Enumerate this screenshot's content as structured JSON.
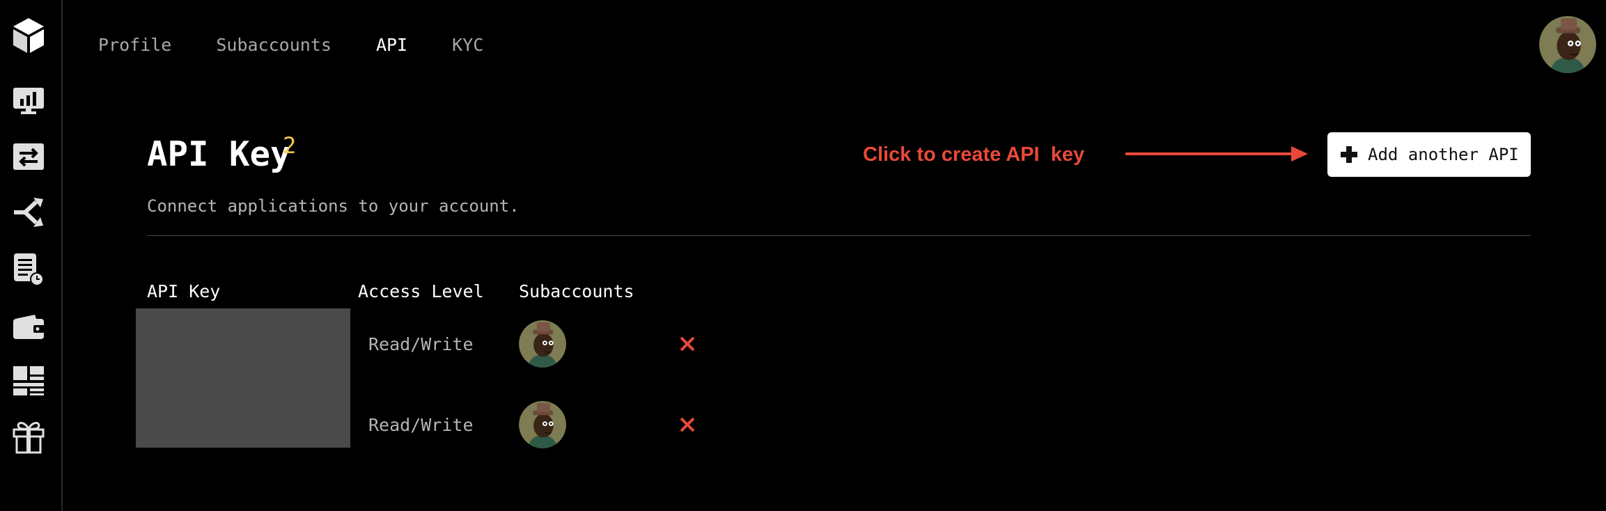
{
  "sidebar": {
    "items": [
      {
        "icon": "logo-cube-icon"
      },
      {
        "icon": "dashboard-chart-icon"
      },
      {
        "icon": "transfer-arrows-icon"
      },
      {
        "icon": "split-arrows-icon"
      },
      {
        "icon": "history-document-icon"
      },
      {
        "icon": "wallet-icon"
      },
      {
        "icon": "grid-table-icon"
      },
      {
        "icon": "gift-icon"
      }
    ]
  },
  "nav": {
    "tabs": [
      {
        "label": "Profile",
        "active": false
      },
      {
        "label": "Subaccounts",
        "active": false
      },
      {
        "label": "API",
        "active": true
      },
      {
        "label": "KYC",
        "active": false
      }
    ]
  },
  "header": {
    "title": "API Key",
    "count": "2",
    "subtitle": "Connect applications to your account.",
    "annotation": "Click to create API  key",
    "add_button_label": "Add another API"
  },
  "table": {
    "headers": [
      "API Key",
      "Access Level",
      "Subaccounts"
    ],
    "rows": [
      {
        "access_level": "Read/Write",
        "subaccount_icon": "avatar-icon",
        "action_icon": "delete-x-icon"
      },
      {
        "access_level": "Read/Write",
        "subaccount_icon": "avatar-icon",
        "action_icon": "delete-x-icon"
      }
    ]
  },
  "colors": {
    "background": "#000000",
    "accent_red": "#e8493a",
    "count_yellow": "#f2c94c",
    "muted_text": "#b5b5b5",
    "redacted": "#4a4a4a"
  }
}
